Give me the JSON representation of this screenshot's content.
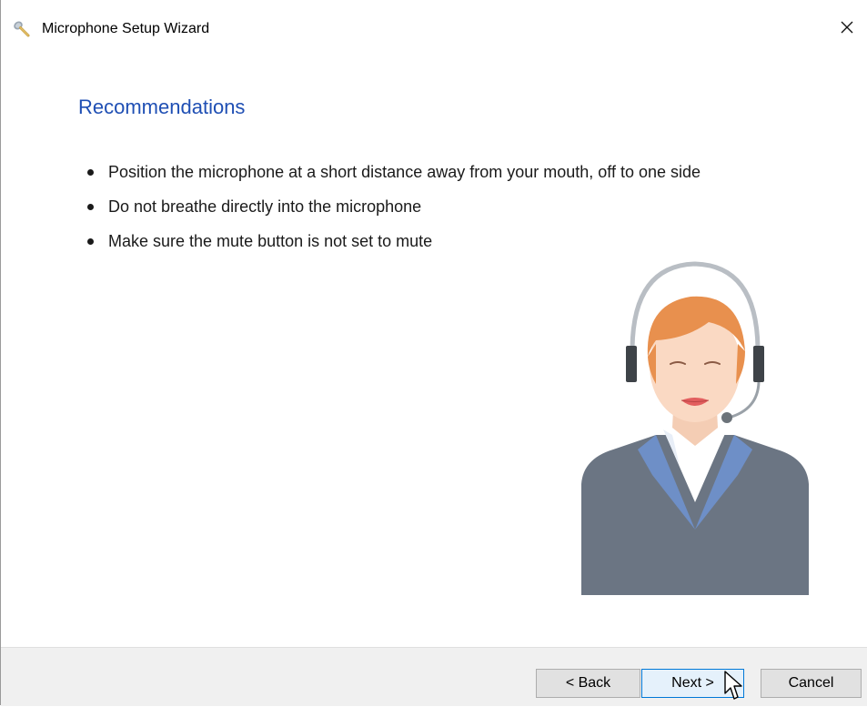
{
  "window": {
    "title": "Microphone Setup Wizard",
    "app_icon": "microphone-icon",
    "close_icon": "close-icon"
  },
  "page": {
    "heading": "Recommendations",
    "bullets": [
      "Position the microphone at a short distance away from your mouth, off to one side",
      "Do not breathe directly into the microphone",
      "Make sure the mute button is not set to mute"
    ],
    "illustration": "headset-operator-illustration"
  },
  "footer": {
    "back_label": "< Back",
    "next_label": "Next >",
    "cancel_label": "Cancel"
  },
  "colors": {
    "heading": "#1f4fb4",
    "footer_bg": "#f0f0f0",
    "focused_button_border": "#0078d7"
  }
}
